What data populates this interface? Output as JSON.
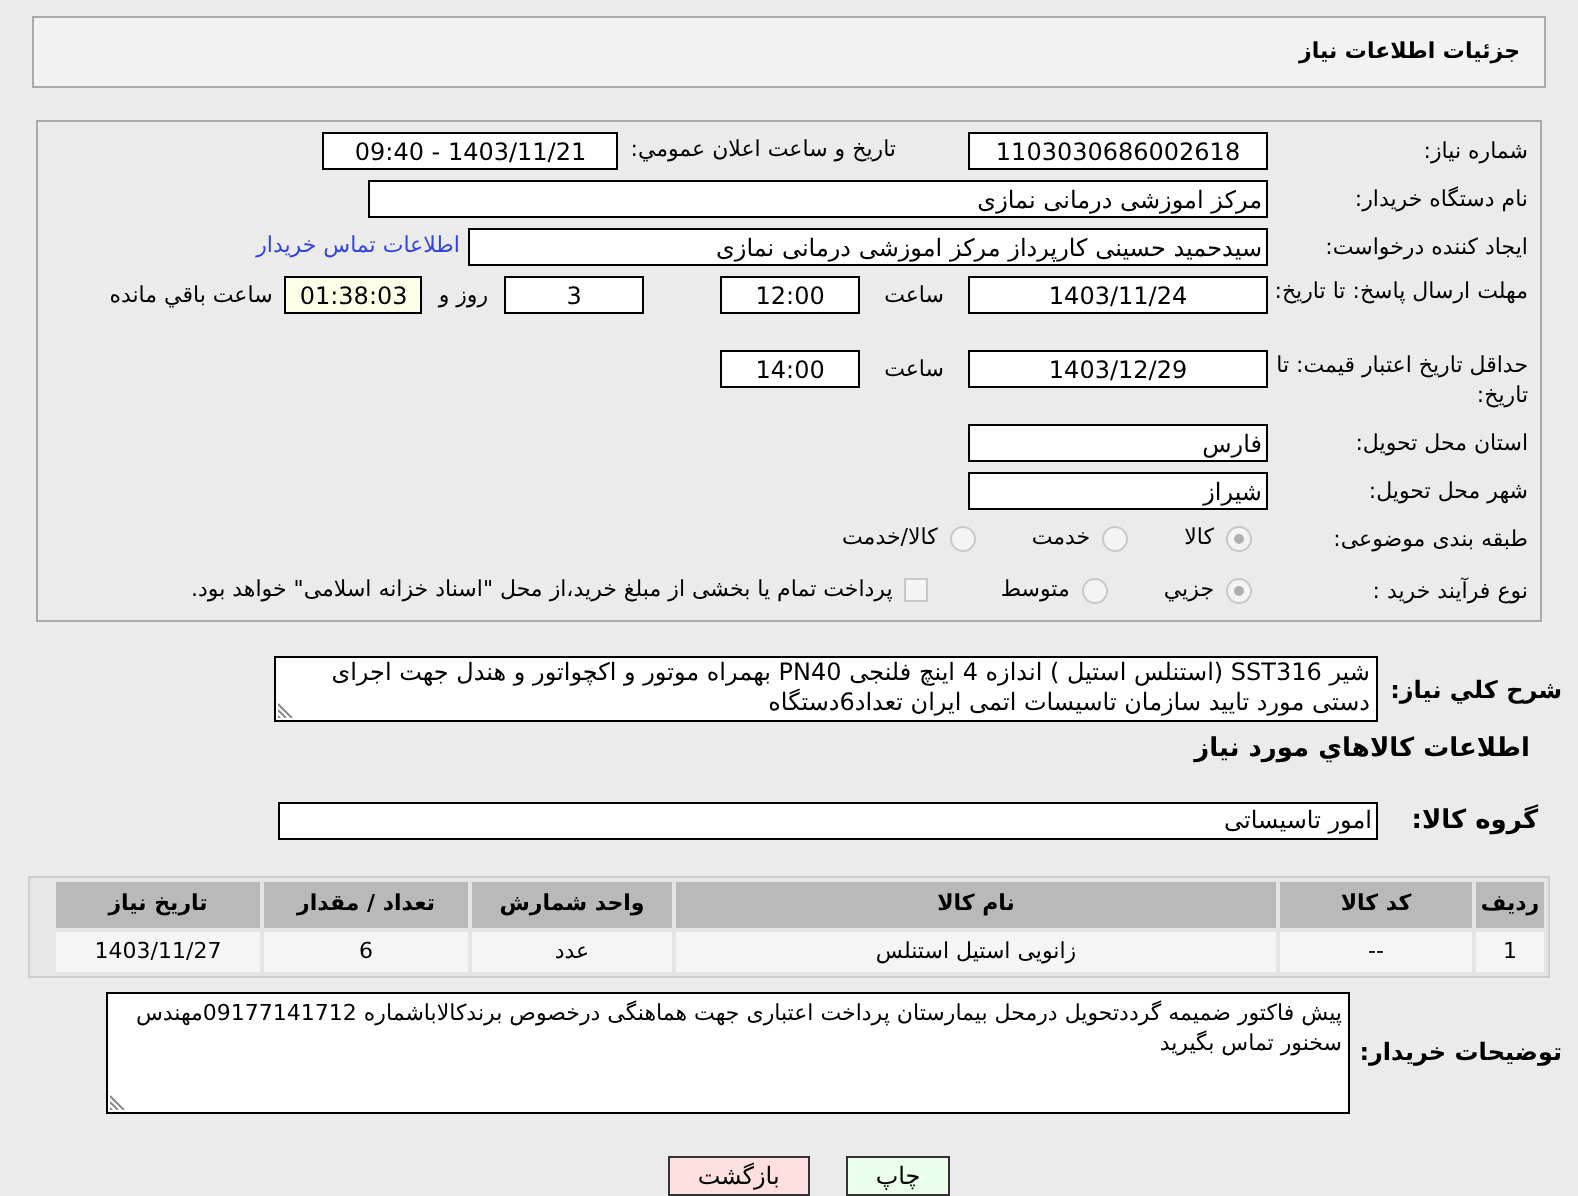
{
  "header": {
    "title": "جزئیات اطلاعات نیاز"
  },
  "need_number": {
    "label": "شماره نیاز:",
    "value": "1103030686002618"
  },
  "announce": {
    "label": "تاریخ و ساعت اعلان عمومي:",
    "value": "1403/11/21 - 09:40"
  },
  "buyer": {
    "label": "نام دستگاه خریدار:",
    "value": "مرکز اموزشی درمانی نمازی"
  },
  "creator": {
    "label": "ایجاد کننده درخواست:",
    "value": "سیدحمید حسینی کارپرداز مرکز اموزشی درمانی نمازی",
    "link": "اطلاعات تماس خریدار"
  },
  "deadline": {
    "label": "مهلت ارسال پاسخ: تا تاریخ:",
    "date": "1403/11/24",
    "time_label": "ساعت",
    "time": "12:00",
    "days": "3",
    "days_label": "روز و",
    "remaining": "01:38:03",
    "remaining_label": "ساعت باقي مانده"
  },
  "validity": {
    "label": "حداقل تاریخ اعتبار قیمت: تا تاریخ:",
    "date": "1403/12/29",
    "time_label": "ساعت",
    "time": "14:00"
  },
  "province": {
    "label": "استان محل تحویل:",
    "value": "فارس"
  },
  "city": {
    "label": "شهر محل تحویل:",
    "value": "شیراز"
  },
  "category": {
    "label": "طبقه بندی موضوعی:",
    "options": [
      {
        "label": "کالا",
        "selected": true
      },
      {
        "label": "خدمت",
        "selected": false
      },
      {
        "label": "کالا/خدمت",
        "selected": false
      }
    ]
  },
  "process": {
    "label": "نوع فرآیند خرید :",
    "options": [
      {
        "label": "جزیي",
        "selected": true
      },
      {
        "label": "متوسط",
        "selected": false
      }
    ],
    "treasury": {
      "label": "پرداخت تمام یا بخشی از مبلغ خرید،از محل \"اسناد خزانه اسلامی\" خواهد بود.",
      "checked": false
    }
  },
  "description": {
    "label": "شرح کلي نیاز:",
    "text": "شیر  SST316 (استنلس استیل )  اندازه 4 اینچ فلنجی PN40 بهمراه موتور و اکچواتور و هندل جهت اجرای دستی  مورد تایید سازمان تاسیسات اتمی ایران تعداد6دستگاه"
  },
  "goods_heading": "اطلاعات کالاهاي مورد نیاز",
  "goods_group": {
    "label": "گروه کالا:",
    "value": "امور تاسیساتی"
  },
  "table": {
    "columns": [
      "ردیف",
      "کد کالا",
      "نام کالا",
      "واحد شمارش",
      "تعداد / مقدار",
      "تاریخ نیاز"
    ],
    "rows": [
      [
        "1",
        "--",
        "زانویی استیل استنلس",
        "عدد",
        "6",
        "1403/11/27"
      ]
    ]
  },
  "buyer_notes": {
    "label": "توضیحات خریدار:",
    "text": "پیش فاکتور ضمیمه گرددتحویل درمحل بیمارستان پرداخت اعتباری جهت هماهنگی درخصوص برندکالاباشماره 09177141712مهندس سخنور تماس بگیرید"
  },
  "buttons": [
    {
      "label": "چاپ",
      "kind": "print"
    },
    {
      "label": "بازگشت",
      "kind": "back"
    }
  ]
}
